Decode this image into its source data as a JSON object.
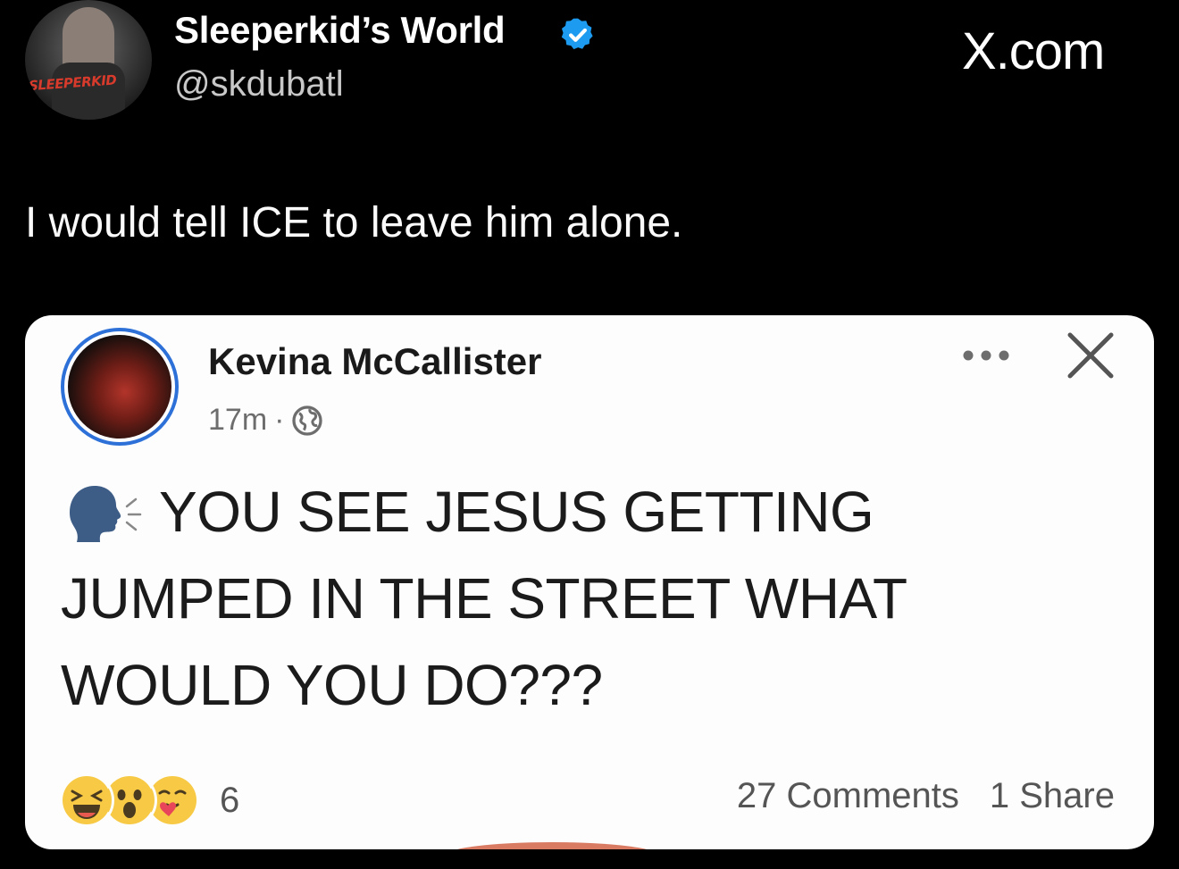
{
  "tweet": {
    "display_name": "Sleeperkid’s World",
    "handle": "@skdubatl",
    "avatar_logo_text": "SLEEPERKID",
    "verified": true,
    "text": "I would tell ICE to leave him alone.",
    "watermark": "X.com"
  },
  "embedded_post": {
    "author": "Kevina McCallister",
    "time": "17m",
    "separator": "·",
    "body": "YOU SEE JESUS GETTING JUMPED IN THE STREET WHAT WOULD YOU DO???",
    "reaction_count": "6",
    "comments": "27 Comments",
    "shares": "1 Share"
  },
  "colors": {
    "background": "#000000",
    "verified": "#1d9bf0",
    "card": "#fdfdfd",
    "avatar_ring": "#2d71d8",
    "speaking_head": "#3d5d87",
    "reaction_yellow": "#f7c944"
  }
}
